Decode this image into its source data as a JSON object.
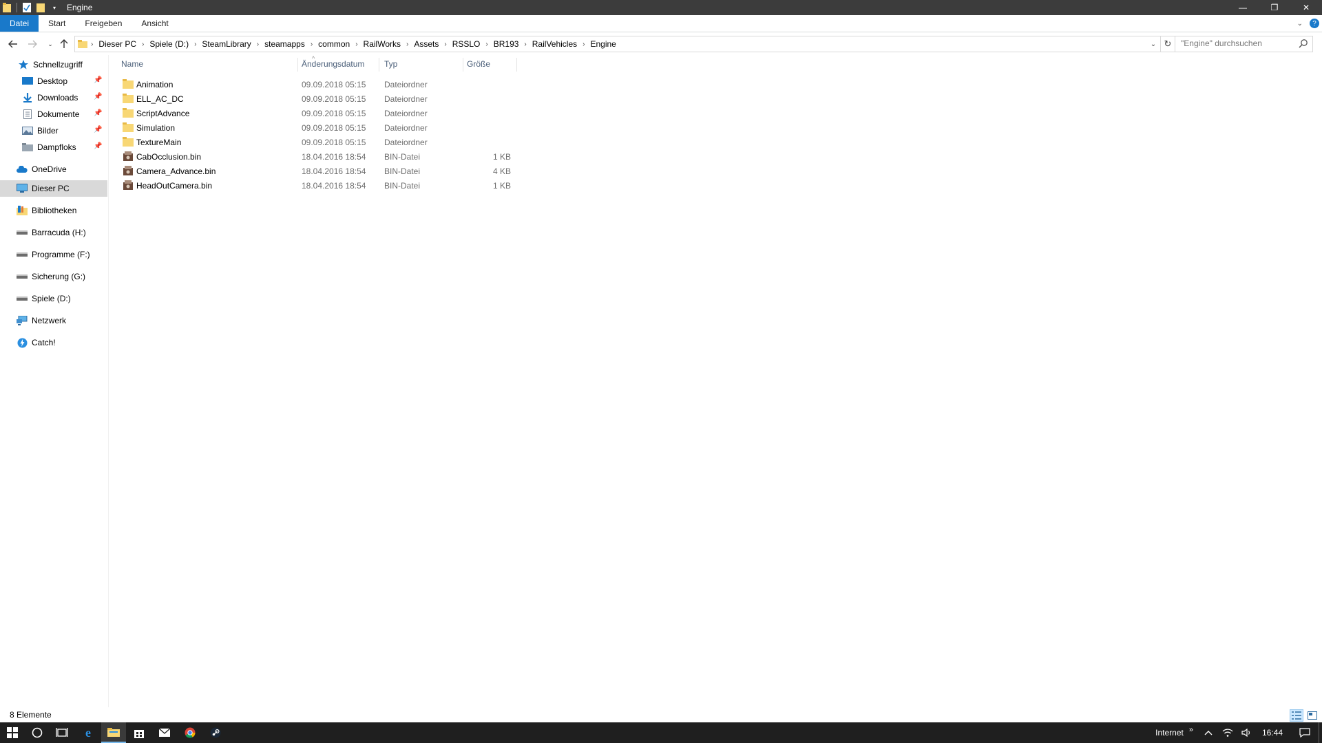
{
  "window": {
    "title": "Engine",
    "controls": {
      "minimize": "—",
      "maximize": "❐",
      "close": "✕"
    }
  },
  "ribbon": {
    "tabs": [
      {
        "label": "Datei",
        "active": true
      },
      {
        "label": "Start"
      },
      {
        "label": "Freigeben"
      },
      {
        "label": "Ansicht"
      }
    ]
  },
  "address": {
    "crumbs": [
      "Dieser PC",
      "Spiele (D:)",
      "SteamLibrary",
      "steamapps",
      "common",
      "RailWorks",
      "Assets",
      "RSSLO",
      "BR193",
      "RailVehicles",
      "Engine"
    ]
  },
  "search": {
    "placeholder": "\"Engine\" durchsuchen"
  },
  "sidebar": {
    "items": [
      {
        "label": "Schnellzugriff",
        "icon": "star-icon"
      },
      {
        "label": "Desktop",
        "icon": "desktop-icon",
        "pinned": true
      },
      {
        "label": "Downloads",
        "icon": "download-icon",
        "pinned": true
      },
      {
        "label": "Dokumente",
        "icon": "document-icon",
        "pinned": true
      },
      {
        "label": "Bilder",
        "icon": "pictures-icon",
        "pinned": true
      },
      {
        "label": "Dampfloks",
        "icon": "folder-icon",
        "pinned": true
      },
      {
        "label": "OneDrive",
        "icon": "cloud-icon"
      },
      {
        "label": "Dieser PC",
        "icon": "computer-icon",
        "selected": true
      },
      {
        "label": "Bibliotheken",
        "icon": "library-icon"
      },
      {
        "label": "Barracuda (H:)",
        "icon": "drive-icon"
      },
      {
        "label": "Programme (F:)",
        "icon": "drive-icon"
      },
      {
        "label": "Sicherung (G:)",
        "icon": "drive-icon"
      },
      {
        "label": "Spiele (D:)",
        "icon": "drive-icon"
      },
      {
        "label": "Netzwerk",
        "icon": "network-icon"
      },
      {
        "label": "Catch!",
        "icon": "catch-icon"
      }
    ]
  },
  "columns": {
    "name": "Name",
    "date": "Änderungsdatum",
    "type": "Typ",
    "size": "Größe"
  },
  "files": [
    {
      "name": "Animation",
      "date": "09.09.2018 05:15",
      "type": "Dateiordner",
      "size": "",
      "kind": "folder"
    },
    {
      "name": "ELL_AC_DC",
      "date": "09.09.2018 05:15",
      "type": "Dateiordner",
      "size": "",
      "kind": "folder"
    },
    {
      "name": "ScriptAdvance",
      "date": "09.09.2018 05:15",
      "type": "Dateiordner",
      "size": "",
      "kind": "folder"
    },
    {
      "name": "Simulation",
      "date": "09.09.2018 05:15",
      "type": "Dateiordner",
      "size": "",
      "kind": "folder"
    },
    {
      "name": "TextureMain",
      "date": "09.09.2018 05:15",
      "type": "Dateiordner",
      "size": "",
      "kind": "folder"
    },
    {
      "name": "CabOcclusion.bin",
      "date": "18.04.2016 18:54",
      "type": "BIN-Datei",
      "size": "1 KB",
      "kind": "bin"
    },
    {
      "name": "Camera_Advance.bin",
      "date": "18.04.2016 18:54",
      "type": "BIN-Datei",
      "size": "4 KB",
      "kind": "bin"
    },
    {
      "name": "HeadOutCamera.bin",
      "date": "18.04.2016 18:54",
      "type": "BIN-Datei",
      "size": "1 KB",
      "kind": "bin"
    }
  ],
  "status": {
    "count": "8 Elemente"
  },
  "taskbar": {
    "tray_label": "Internet",
    "tray_chevron": "»",
    "time": "16:44"
  },
  "colors": {
    "accent": "#1979ca",
    "folder": "#f8d775",
    "taskbar": "#1f1f1f",
    "titlebar": "#3c3c3c"
  }
}
